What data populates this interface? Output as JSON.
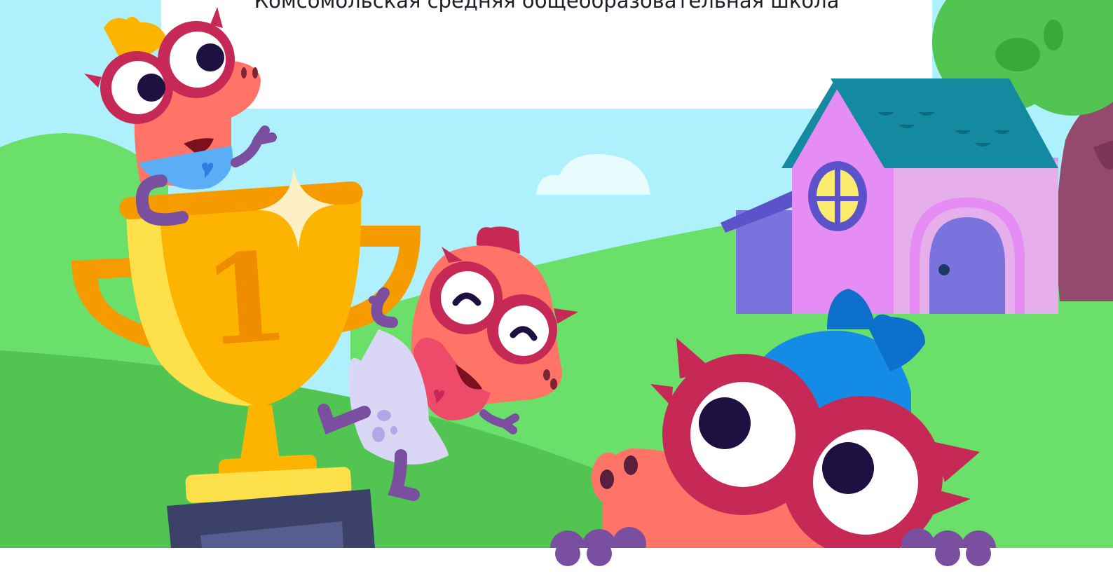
{
  "header": {
    "school_name": "Комсомольская средняя общеобразовательная школа"
  },
  "illustration": {
    "trophy_number": "1",
    "icons": [
      "trophy-icon",
      "house-icon",
      "tree-icon",
      "cloud-icon",
      "sparkle-icon",
      "heart-icon"
    ],
    "colors": {
      "sky": "#aef0fb",
      "grass_light": "#6ae06a",
      "grass_dark": "#52c452",
      "trophy_gold": "#fdb400",
      "trophy_orange": "#f59b00",
      "dino_body": "#ff7466",
      "glasses": "#c72956",
      "house_wall": "#e58cf5",
      "house_roof": "#138aa0",
      "bow_blue": "#148ce6"
    }
  }
}
